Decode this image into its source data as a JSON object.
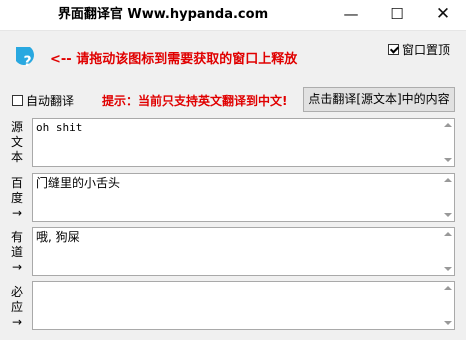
{
  "window": {
    "title": "界面翻译官  Www.hypanda.com",
    "minimize_glyph": "—",
    "maximize_glyph": "☐",
    "close_glyph": "✕"
  },
  "header": {
    "drag_icon": "question-drop-icon",
    "drag_icon_color": "#29a8e0",
    "hint_text": "<--  请拖动该图标到需要获取的窗口上释放",
    "topmost_label": "窗口置顶",
    "topmost_checked": true
  },
  "toolbar": {
    "auto_translate_label": "自动翻译",
    "auto_translate_checked": false,
    "notice_text": "提示：当前只支持英文翻译到中文!",
    "translate_button_label": "点击翻译[源文本]中的内容"
  },
  "panels": {
    "source_label": "源文本",
    "source_text": "oh shit",
    "baidu_label": "百度→",
    "baidu_text": "门缝里的小舌头",
    "youdao_label": "有道→",
    "youdao_text": "哦, 狗屎",
    "bing_label": "必应→",
    "bing_text": ""
  },
  "colors": {
    "hint_red": "#e00000",
    "background": "#f0f0f0"
  }
}
